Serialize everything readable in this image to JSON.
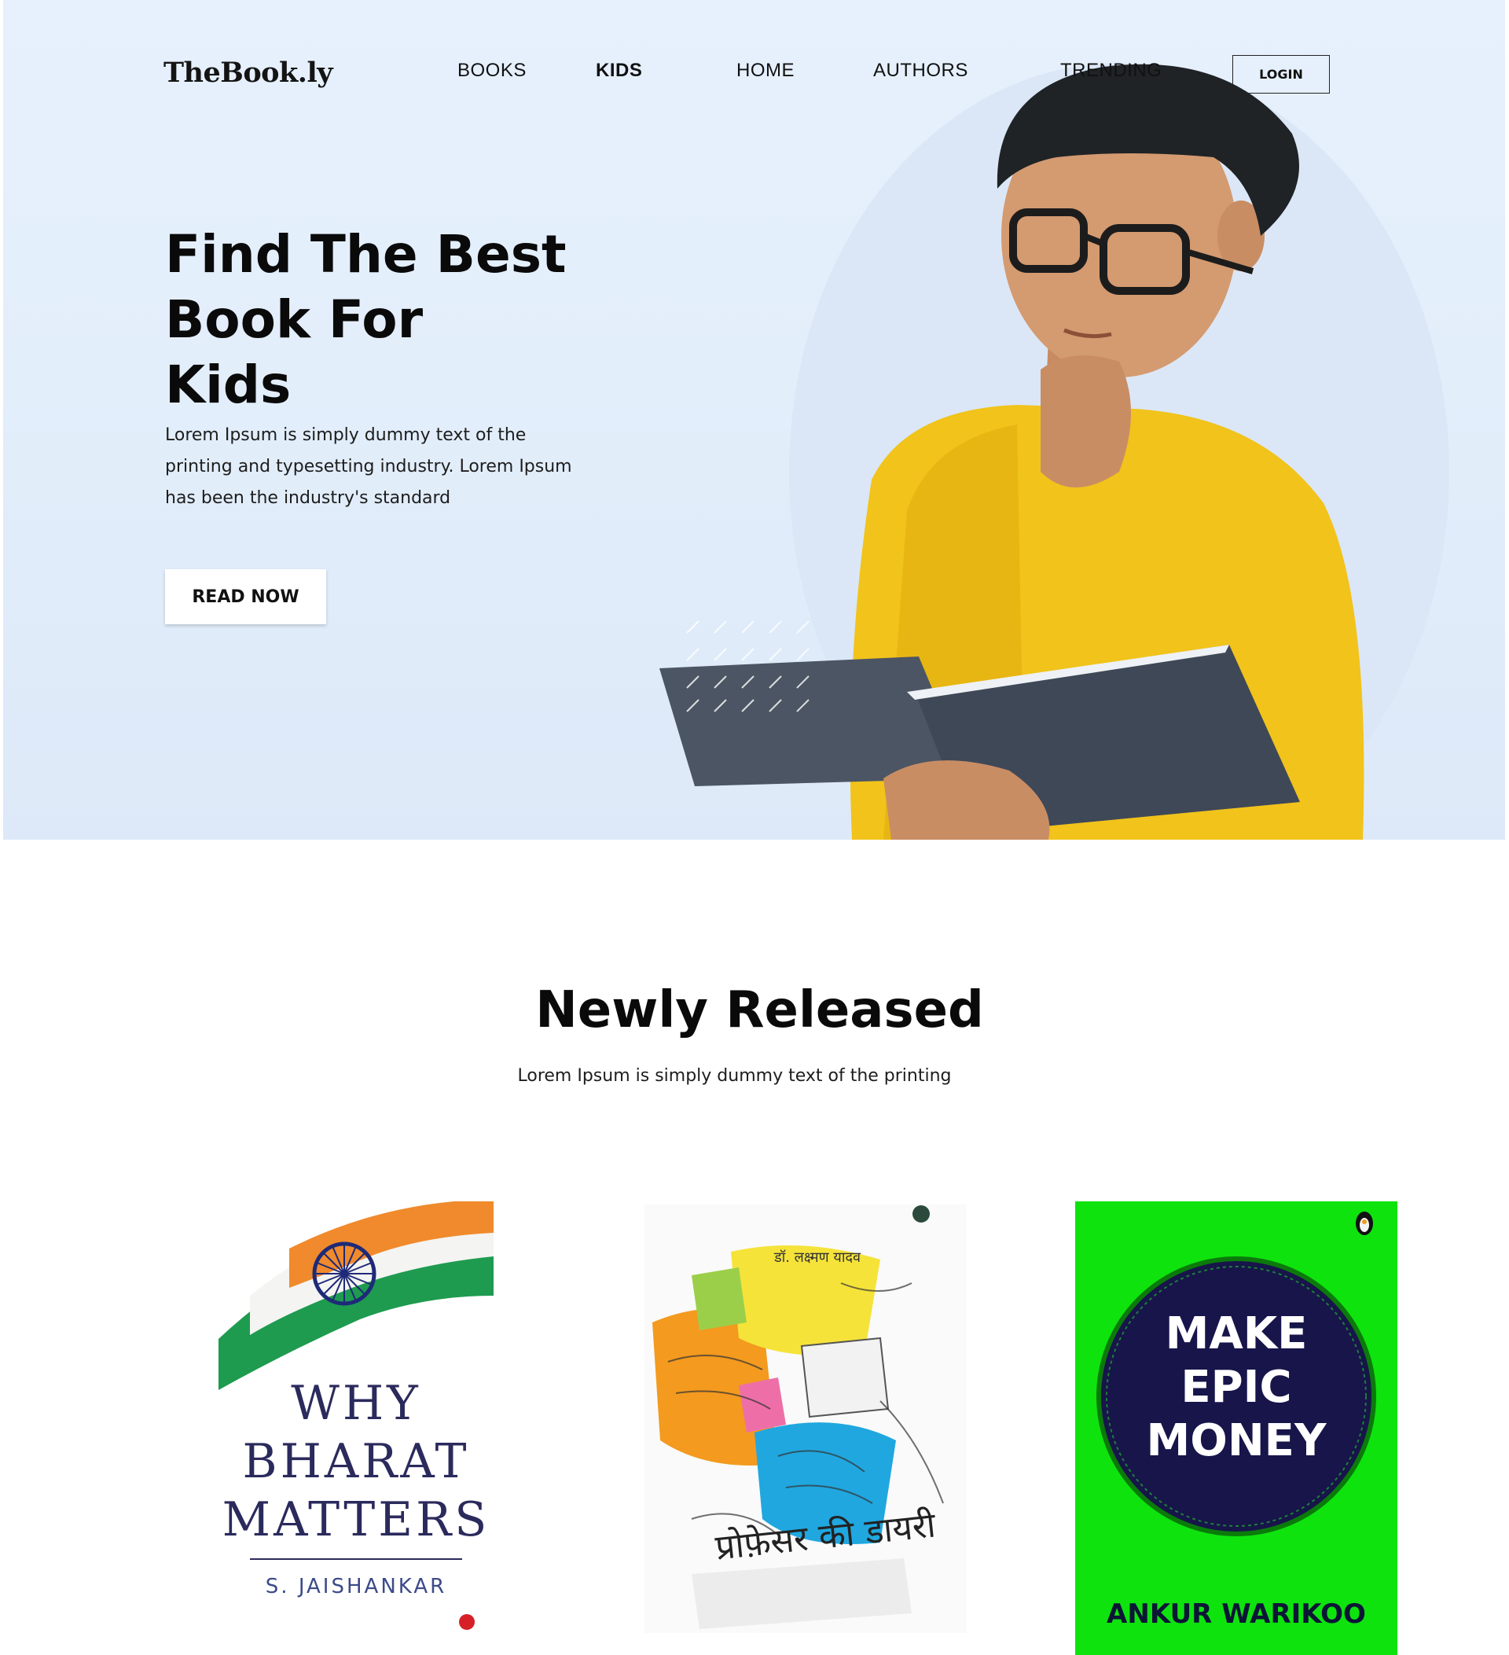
{
  "header": {
    "logo": "TheBook.ly",
    "nav": [
      {
        "label": "BOOKS",
        "active": false
      },
      {
        "label": "KIDS",
        "active": true
      },
      {
        "label": "HOME",
        "active": false
      },
      {
        "label": "AUTHORS",
        "active": false
      },
      {
        "label": "TRENDING",
        "active": false
      }
    ],
    "login_label": "LOGIN"
  },
  "hero": {
    "title_lines": [
      "Find The Best",
      "Book For",
      "Kids"
    ],
    "description": "Lorem Ipsum is simply dummy text of the printing and typesetting industry. Lorem Ipsum has been the industry's standard",
    "cta_label": "READ NOW",
    "background_color": "#e5effc"
  },
  "section": {
    "title": "Newly Released",
    "subtitle": "Lorem Ipsum is simply dummy text of the printing"
  },
  "books": [
    {
      "title_lines": [
        "WHY",
        "BHARAT",
        "MATTERS"
      ],
      "author": "S. JAISHANKAR"
    },
    {
      "author": "डॉ. लक्ष्मण यादव",
      "title": "प्रोफ़ेसर की डायरी"
    },
    {
      "title_lines": [
        "MAKE",
        "EPIC",
        "MONEY"
      ],
      "author": "ANKUR WARIKOO",
      "background_color": "#0ee30e"
    }
  ]
}
